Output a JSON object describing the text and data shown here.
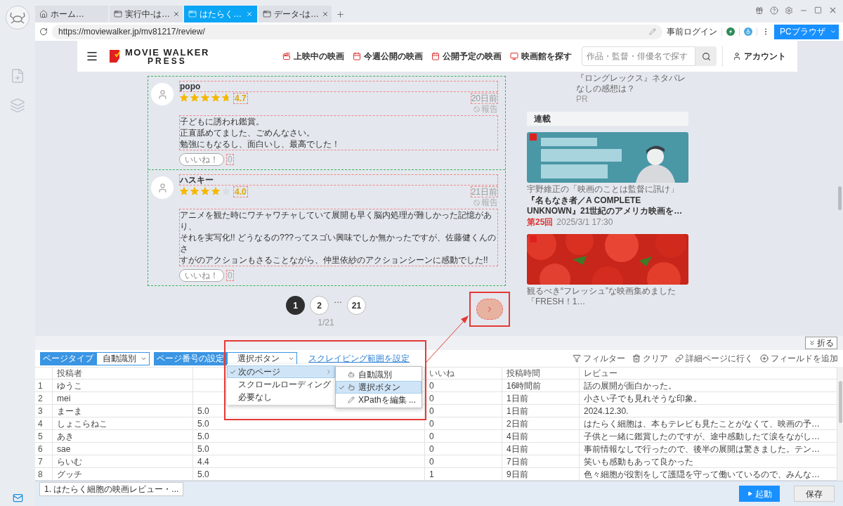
{
  "tabs": [
    {
      "label": "ホーム…",
      "kind": "home",
      "selected": false
    },
    {
      "label": "実行中-は…",
      "kind": "page",
      "selected": false
    },
    {
      "label": "はたらく…",
      "kind": "page",
      "selected": true
    },
    {
      "label": "データ-は…",
      "kind": "page",
      "selected": false
    }
  ],
  "address": {
    "url": "https://moviewalker.jp/mv81217/review/",
    "login": "事前ログイン",
    "mode_button": "PCブラウザ"
  },
  "site": {
    "logo_top": "MOVIE WALKER",
    "logo_bottom": "PRESS",
    "nav": [
      {
        "label": "上映中の映画",
        "kind": "showing"
      },
      {
        "label": "今週公開の映画",
        "kind": "calendar"
      },
      {
        "label": "公開予定の映画",
        "kind": "calendar"
      },
      {
        "label": "映画館を探す",
        "kind": "theater"
      }
    ],
    "search_placeholder": "作品・監督・俳優名で探す",
    "account": "アカウント"
  },
  "reviews": [
    {
      "name": "popo",
      "stars": 4.7,
      "rating": "4.7",
      "time": "20日前",
      "report": "報告",
      "lines": [
        "子どもに誘われ鑑賞。",
        "正直舐めてました、ごめんなさい。",
        "勉強にもなるし、面白いし、最高でした！"
      ],
      "like": "いいね！",
      "like_count": "0"
    },
    {
      "name": "ハスキー",
      "stars": 4,
      "rating": "4.0",
      "time": "21日前",
      "report": "報告",
      "lines": [
        "アニメを観た時にワチャワチャしていて展開も早く脳内処理が難しかった記憶があり、",
        "それを実写化!! どうなるの???ってスゴい興味でしか無かったですが、佐藤健くんのさ",
        "すがのアクションもさることながら、仲里依紗のアクションシーンに感動でした!!"
      ],
      "like": "いいね！",
      "like_count": "0"
    }
  ],
  "pagination": {
    "pages": [
      {
        "label": "1",
        "kind": "page",
        "selected": true
      },
      {
        "label": "2",
        "kind": "page",
        "selected": false
      },
      {
        "label": "…",
        "kind": "gap"
      },
      {
        "label": "21",
        "kind": "page",
        "selected": false
      }
    ],
    "summary": "1/21"
  },
  "sidebar": {
    "promo": "『ロングレックス』ネタバレなしの感想は？",
    "promo_tag": "PR",
    "section": "連載",
    "articles": [
      {
        "caption": "宇野維正の「映画のことは監督に訊け」",
        "title": "『名もなき者／A COMPLETE UNKNOWN』21世紀のアメリカ映画を…",
        "episode": "第25回",
        "date": "2025/3/1 17:30"
      },
      {
        "caption": "観るべき“フレッシュ”な映画集めました「FRESH！1…"
      }
    ]
  },
  "panel": {
    "fold": "折る",
    "page_type": {
      "label": "ページタイプ",
      "value": "自動識別"
    },
    "page_number": {
      "label": "ページ番号の設定",
      "value": "選択ボタン"
    },
    "range_link": "スクレイピング範囲を設定",
    "actions": [
      {
        "kind": "filter",
        "label": "フィルター"
      },
      {
        "kind": "clear",
        "label": "クリア"
      },
      {
        "kind": "detail",
        "label": "詳細ページに行く"
      },
      {
        "kind": "add",
        "label": "フィールドを追加"
      }
    ]
  },
  "menu": {
    "items": [
      {
        "label": "次のページ",
        "selected": true,
        "checked": true,
        "has_submenu": true
      },
      {
        "label": "スクロールローディング",
        "selected": false,
        "checked": false,
        "has_submenu": false
      },
      {
        "label": "必要なし",
        "selected": false,
        "checked": false,
        "has_submenu": false
      }
    ],
    "submenu": [
      {
        "label": "自動識別",
        "kind": "auto",
        "selected": false,
        "checked": false
      },
      {
        "label": "選択ボタン",
        "kind": "click",
        "selected": true,
        "checked": true
      },
      {
        "label": "XPathを編集 ...",
        "kind": "xpath",
        "selected": false,
        "checked": false
      }
    ]
  },
  "table": {
    "columns": [
      {
        "label": "投稿者"
      },
      {},
      {
        "label": "いいね"
      },
      {
        "label": "投稿時間"
      },
      {
        "label": "レビュー"
      }
    ],
    "rows": [
      {
        "index": "1",
        "cells": [
          "ゆうこ",
          null,
          "0",
          "16時間前",
          "話の展開が面白かった。"
        ]
      },
      {
        "index": "2",
        "cells": [
          "mei",
          null,
          "0",
          "1日前",
          "小さい子でも見れそうな印象。"
        ]
      },
      {
        "index": "3",
        "cells": [
          "まーま",
          "5.0",
          "0",
          "1日前",
          "2024.12.30."
        ]
      },
      {
        "index": "4",
        "cells": [
          "しょこらねこ",
          "5.0",
          "0",
          "2日前",
          "はたらく細胞は、本もテレビも見たことがなくて、映画の予…"
        ]
      },
      {
        "index": "5",
        "cells": [
          "あき",
          "5.0",
          "0",
          "4日前",
          "子供と一緒に鑑賞したのですが、途中感動したて涙をながし…"
        ]
      },
      {
        "index": "6",
        "cells": [
          "sae",
          "5.0",
          "0",
          "4日前",
          "事前情報なしで行ったので、後半の展開は驚きました。テン…"
        ]
      },
      {
        "index": "7",
        "cells": [
          "らいむ",
          "4.4",
          "0",
          "7日前",
          "笑いも感動もあって良かった"
        ]
      },
      {
        "index": "8",
        "cells": [
          "グッチ",
          "5.0",
          "1",
          "9日前",
          "色々細胞が役割をして護隠を守って働いているので、みんな…"
        ]
      }
    ]
  },
  "footer": {
    "task": "1. はたらく細胞の映画レビュー・...",
    "start": "起動",
    "save": "保存"
  }
}
